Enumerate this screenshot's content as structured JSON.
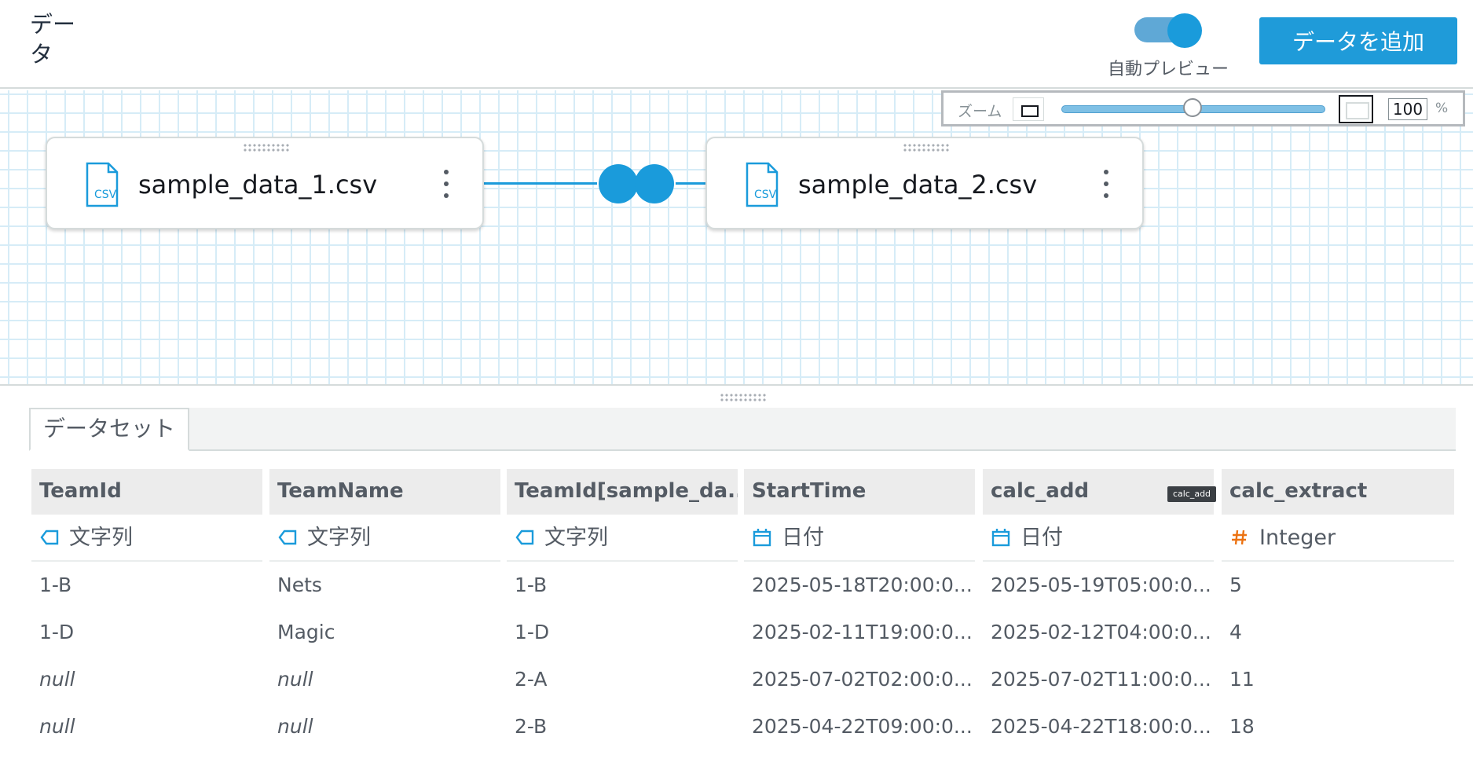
{
  "header": {
    "title": "データ",
    "auto_preview_label": "自動プレビュー",
    "add_data_label": "データを追加"
  },
  "zoom": {
    "label": "ズーム",
    "value": "100",
    "unit": "%",
    "level": 100
  },
  "nodes": [
    {
      "icon": "csv-file-icon",
      "icon_text": "CSV",
      "name": "sample_data_1.csv"
    },
    {
      "icon": "csv-file-icon",
      "icon_text": "CSV",
      "name": "sample_data_2.csv"
    }
  ],
  "join": {
    "icon": "inner-join-icon"
  },
  "tabs": {
    "dataset_label": "データセット"
  },
  "table": {
    "columns": [
      {
        "header": "TeamId",
        "type_label": "文字列",
        "type_icon": "string-tag-icon"
      },
      {
        "header": "TeamName",
        "type_label": "文字列",
        "type_icon": "string-tag-icon"
      },
      {
        "header": "TeamId[sample_da...",
        "type_label": "文字列",
        "type_icon": "string-tag-icon"
      },
      {
        "header": "StartTime",
        "type_label": "日付",
        "type_icon": "calendar-icon"
      },
      {
        "header": "calc_add",
        "type_label": "日付",
        "type_icon": "calendar-icon"
      },
      {
        "header": "calc_extract",
        "type_label": "Integer",
        "type_icon": "hash-icon"
      }
    ],
    "rows": [
      [
        "1-B",
        "Nets",
        "1-B",
        "2025-05-18T20:00:0...",
        "2025-05-19T05:00:0...",
        "5"
      ],
      [
        "1-D",
        "Magic",
        "1-D",
        "2025-02-11T19:00:0...",
        "2025-02-12T04:00:0...",
        "4"
      ],
      [
        "null",
        "null",
        "2-A",
        "2025-07-02T02:00:0...",
        "2025-07-02T11:00:0...",
        "11"
      ],
      [
        "null",
        "null",
        "2-B",
        "2025-04-22T09:00:0...",
        "2025-04-22T18:00:0...",
        "18"
      ]
    ],
    "tooltip": "calc_add"
  },
  "colors": {
    "accent": "#1a9bdb",
    "button": "#1f9bd9",
    "grid_line": "#d6ecf7",
    "hash_icon": "#ec7211"
  }
}
